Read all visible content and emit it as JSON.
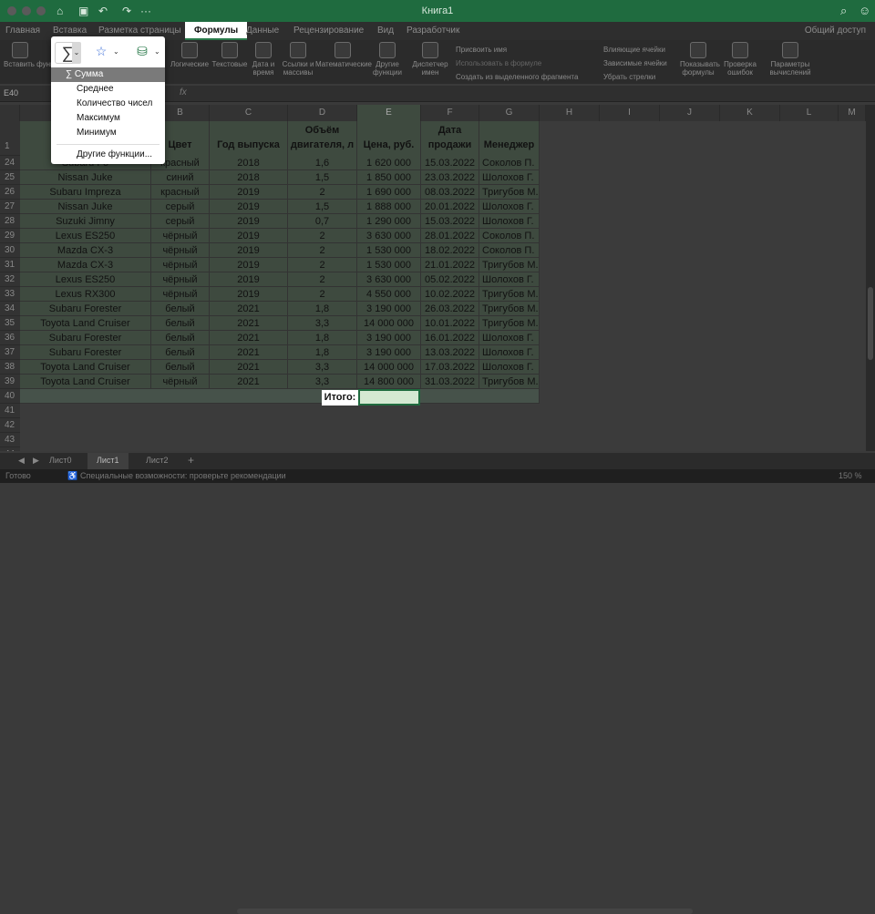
{
  "window": {
    "title": "Книга1"
  },
  "ribbon_tabs": [
    "Главная",
    "Вставка",
    "Разметка страницы",
    "Формулы",
    "Данные",
    "Рецензирование",
    "Вид",
    "Разработчик"
  ],
  "active_tab": "Формулы",
  "share_label": "Общий доступ",
  "ribbon": {
    "insert_function": "Вставить функцию",
    "logical": "Логические",
    "text": "Текстовые",
    "datetime": "Дата и время",
    "lookup": "Ссылки и массивы",
    "math": "Математические",
    "other": "Другие функции",
    "name_manager": "Диспетчер имен",
    "assign_name": "Присвоить имя",
    "use_in_formula": "Использовать в формуле",
    "create_from_selection": "Создать из выделенного фрагмента",
    "trace_precedents": "Влияющие ячейки",
    "trace_dependents": "Зависимые ячейки",
    "remove_arrows": "Убрать стрелки",
    "show_formulas": "Показывать формулы",
    "error_checking": "Проверка ошибок",
    "calc_options": "Параметры вычислений"
  },
  "formula_bar": {
    "name_box": "E40",
    "fx": "fx",
    "value": ""
  },
  "dropdown": {
    "items": [
      "Сумма",
      "Среднее",
      "Количество чисел",
      "Максимум",
      "Минимум"
    ],
    "selected": "Сумма",
    "more": "Другие функции..."
  },
  "columns": [
    "A",
    "B",
    "C",
    "D",
    "E",
    "F",
    "G",
    "H",
    "I",
    "J",
    "K",
    "L",
    "M"
  ],
  "headers": {
    "A": "М",
    "B": "Цвет",
    "C": "Год выпуска",
    "D": "Объём\nдвигателя, л",
    "E": "Цена, руб.",
    "F": "Дата\nпродажи",
    "G": "Менеджер"
  },
  "rows": [
    {
      "n": "24",
      "a": "Subaru Fo",
      "b": "красный",
      "c": "2018",
      "d": "1,6",
      "e": "1 620 000",
      "f": "15.03.2022",
      "g": "Соколов П."
    },
    {
      "n": "25",
      "a": "Nissan Juke",
      "b": "синий",
      "c": "2018",
      "d": "1,5",
      "e": "1 850 000",
      "f": "23.03.2022",
      "g": "Шолохов Г."
    },
    {
      "n": "26",
      "a": "Subaru Impreza",
      "b": "красный",
      "c": "2019",
      "d": "2",
      "e": "1 690 000",
      "f": "08.03.2022",
      "g": "Тригубов М."
    },
    {
      "n": "27",
      "a": "Nissan Juke",
      "b": "серый",
      "c": "2019",
      "d": "1,5",
      "e": "1 888 000",
      "f": "20.01.2022",
      "g": "Шолохов Г."
    },
    {
      "n": "28",
      "a": "Suzuki Jimny",
      "b": "серый",
      "c": "2019",
      "d": "0,7",
      "e": "1 290 000",
      "f": "15.03.2022",
      "g": "Шолохов Г."
    },
    {
      "n": "29",
      "a": "Lexus ES250",
      "b": "чёрный",
      "c": "2019",
      "d": "2",
      "e": "3 630 000",
      "f": "28.01.2022",
      "g": "Соколов П."
    },
    {
      "n": "30",
      "a": "Mazda CX-3",
      "b": "чёрный",
      "c": "2019",
      "d": "2",
      "e": "1 530 000",
      "f": "18.02.2022",
      "g": "Соколов П."
    },
    {
      "n": "31",
      "a": "Mazda CX-3",
      "b": "чёрный",
      "c": "2019",
      "d": "2",
      "e": "1 530 000",
      "f": "21.01.2022",
      "g": "Тригубов М."
    },
    {
      "n": "32",
      "a": "Lexus ES250",
      "b": "чёрный",
      "c": "2019",
      "d": "2",
      "e": "3 630 000",
      "f": "05.02.2022",
      "g": "Шолохов Г."
    },
    {
      "n": "33",
      "a": "Lexus RX300",
      "b": "чёрный",
      "c": "2019",
      "d": "2",
      "e": "4 550 000",
      "f": "10.02.2022",
      "g": "Тригубов М."
    },
    {
      "n": "34",
      "a": "Subaru Forester",
      "b": "белый",
      "c": "2021",
      "d": "1,8",
      "e": "3 190 000",
      "f": "26.03.2022",
      "g": "Тригубов М."
    },
    {
      "n": "35",
      "a": "Toyota Land Cruiser",
      "b": "белый",
      "c": "2021",
      "d": "3,3",
      "e": "14 000 000",
      "f": "10.01.2022",
      "g": "Тригубов М."
    },
    {
      "n": "36",
      "a": "Subaru Forester",
      "b": "белый",
      "c": "2021",
      "d": "1,8",
      "e": "3 190 000",
      "f": "16.01.2022",
      "g": "Шолохов Г."
    },
    {
      "n": "37",
      "a": "Subaru Forester",
      "b": "белый",
      "c": "2021",
      "d": "1,8",
      "e": "3 190 000",
      "f": "13.03.2022",
      "g": "Шолохов Г."
    },
    {
      "n": "38",
      "a": "Toyota Land Cruiser",
      "b": "белый",
      "c": "2021",
      "d": "3,3",
      "e": "14 000 000",
      "f": "17.03.2022",
      "g": "Шолохов Г."
    },
    {
      "n": "39",
      "a": "Toyota Land Cruiser",
      "b": "чёрный",
      "c": "2021",
      "d": "3,3",
      "e": "14 800 000",
      "f": "31.03.2022",
      "g": "Тригубов М."
    }
  ],
  "empty_rows": [
    "40",
    "41",
    "42",
    "43",
    "44"
  ],
  "header_row_number": "1",
  "total_label": "Итого:",
  "sheets": [
    "Лист0",
    "Лист1",
    "Лист2"
  ],
  "active_sheet": "Лист1",
  "status": {
    "ready": "Готово",
    "accessibility": "Специальные возможности: проверьте рекомендации",
    "zoom": "150 %"
  }
}
